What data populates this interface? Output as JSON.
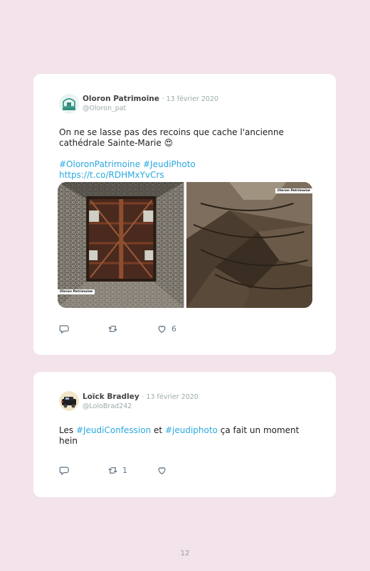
{
  "tweets": [
    {
      "name": "Oloron Patrimoine",
      "date": "· 13 février 2020",
      "handle": "@Oloron_pat",
      "text_line1": "On ne se lasse pas des recoins que cache l'ancienne",
      "text_line2": "cathédrale Sainte-Marie",
      "emoji": "😍",
      "hashtag1": "#OloronPatrimoine",
      "hashtag2": "#JeudiPhoto",
      "link": "https://t.co/RDHMxYvCrs",
      "photo_credit_left": "Oloron Patrimoine",
      "photo_credit_right": "Oloron Patrimoine",
      "retweets": "",
      "likes": "6"
    },
    {
      "name": "Loïck Bradley",
      "date": "· 13 février 2020",
      "handle": "@LoloBrad242",
      "text_prefix": "Les",
      "hashtag1": "#JeudiConfession",
      "text_mid": "et",
      "hashtag2": "#jeudiphoto",
      "text_suffix": "ça fait un moment",
      "text_line2": "hein",
      "retweets": "1",
      "likes": ""
    }
  ],
  "page_number": "12",
  "icons": [
    "reply-icon",
    "retweet-icon",
    "like-icon"
  ],
  "colors": {
    "background": "#f3e3ea",
    "card": "#ffffff",
    "link": "#2aa9e0",
    "meta": "#9aa"
  }
}
